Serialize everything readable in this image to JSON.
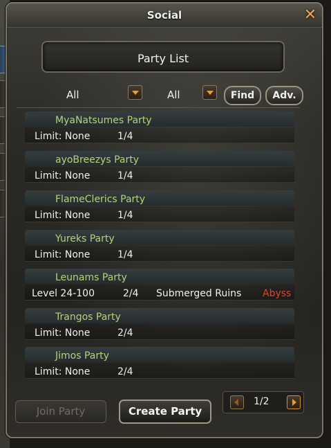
{
  "window": {
    "title": "Social",
    "close_icon": "close-icon"
  },
  "header": {
    "title": "Party List"
  },
  "filters": {
    "filter1_value": "All",
    "filter2_value": "All",
    "find_label": "Find",
    "adv_label": "Adv."
  },
  "parties": [
    {
      "name": "MyaNatsumes Party",
      "limit": "Limit: None",
      "members": "1/4",
      "location": "",
      "type": ""
    },
    {
      "name": "ayoBreezys Party",
      "limit": "Limit: None",
      "members": "1/4",
      "location": "",
      "type": ""
    },
    {
      "name": "FlameClerics Party",
      "limit": "Limit: None",
      "members": "1/4",
      "location": "",
      "type": ""
    },
    {
      "name": "Yureks Party",
      "limit": "Limit: None",
      "members": "1/4",
      "location": "",
      "type": ""
    },
    {
      "name": "Leunams Party",
      "limit": "Level 24-100",
      "members": "2/4",
      "location": "Submerged Ruins",
      "type": "Abyss"
    },
    {
      "name": "Trangos Party",
      "limit": "Limit: None",
      "members": "2/4",
      "location": "",
      "type": ""
    },
    {
      "name": "Jimos Party",
      "limit": "Limit: None",
      "members": "2/4",
      "location": "",
      "type": ""
    }
  ],
  "footer": {
    "join_label": "Join Party",
    "create_label": "Create Party",
    "page": "1/2"
  },
  "colors": {
    "party_name": "#b5d27a",
    "abyss": "#e0412c",
    "accent": "#f19a2c"
  }
}
